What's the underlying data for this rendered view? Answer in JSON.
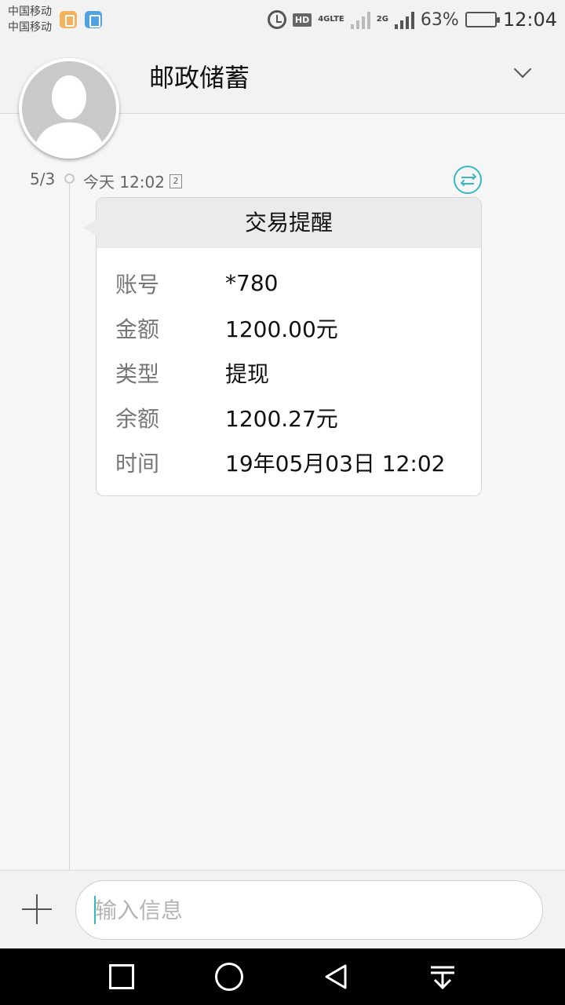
{
  "status_bar": {
    "carrier_1": "中国移动",
    "carrier_2": "中国移动",
    "hd": "HD",
    "net_4g": "4G",
    "net_lte": "LTE",
    "net_2g": "2G",
    "battery_percent": "63%",
    "battery_level": 0.63,
    "time": "12:04"
  },
  "header": {
    "contact_name": "邮政储蓄"
  },
  "thread": {
    "date": "5/3",
    "message_time": "今天 12:02",
    "sim_slot": "2"
  },
  "message": {
    "title": "交易提醒",
    "rows": [
      {
        "label": "账号",
        "value": "*780"
      },
      {
        "label": "金额",
        "value": "1200.00元"
      },
      {
        "label": "类型",
        "value": "提现"
      },
      {
        "label": "余额",
        "value": "1200.27元"
      },
      {
        "label": "时间",
        "value": "19年05月03日 12:02"
      }
    ]
  },
  "composer": {
    "placeholder": "输入信息",
    "value": ""
  },
  "colors": {
    "accent": "#36b8c3"
  }
}
